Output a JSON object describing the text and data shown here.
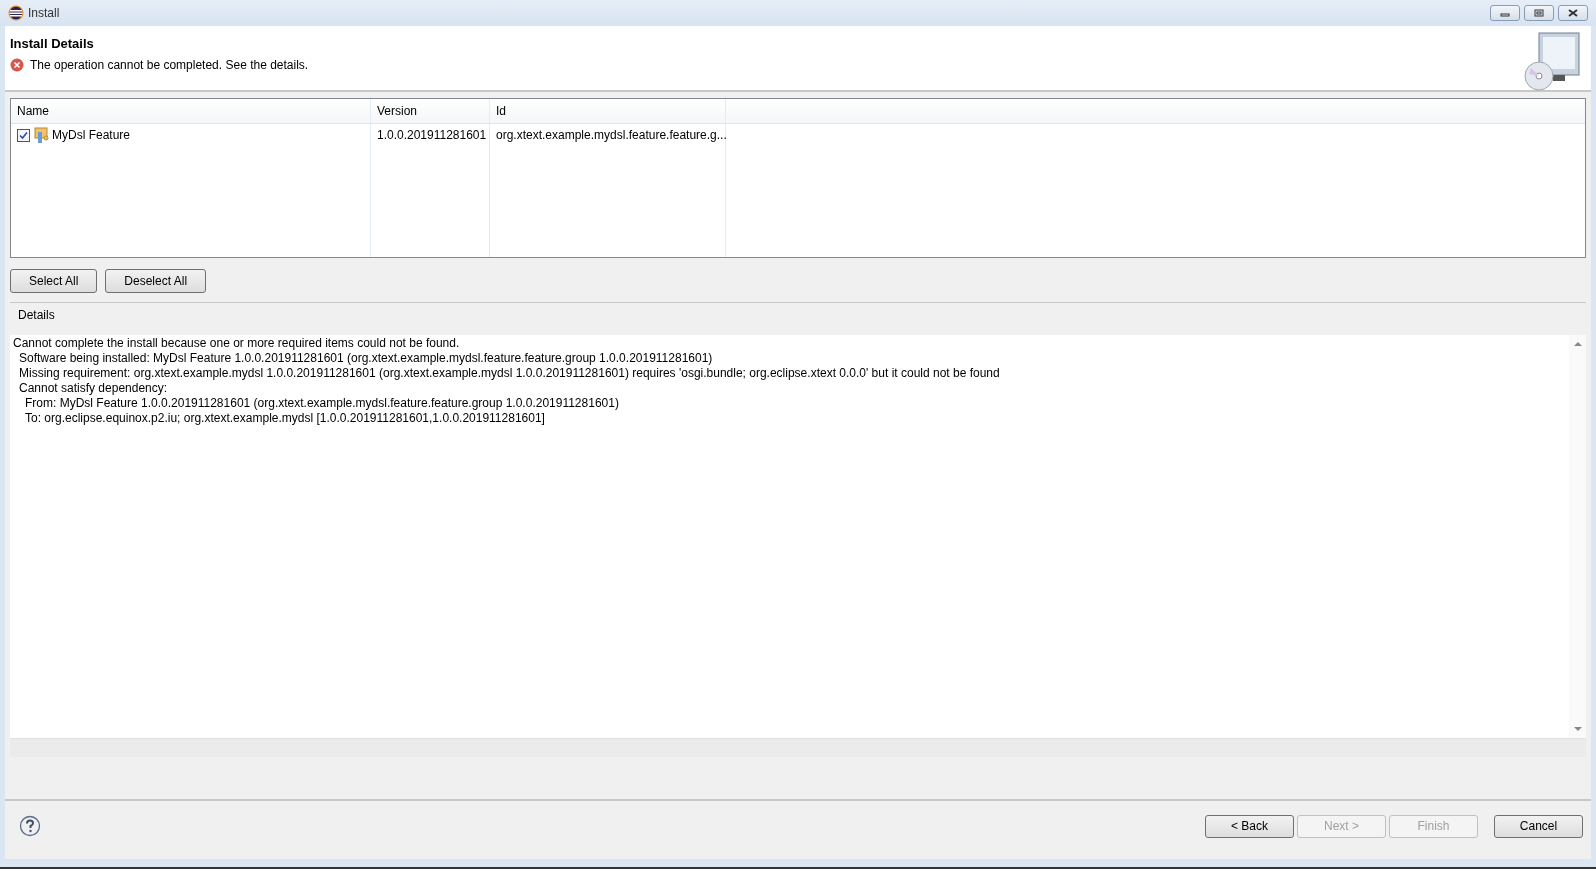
{
  "window": {
    "title": "Install"
  },
  "header": {
    "title": "Install Details",
    "message": "The operation cannot be completed.  See the details."
  },
  "table": {
    "columns": [
      "Name",
      "Version",
      "Id"
    ],
    "rows": [
      {
        "name": "MyDsl Feature",
        "version": "1.0.0.201911281601",
        "id": "org.xtext.example.mydsl.feature.feature.g...",
        "checked": true
      }
    ]
  },
  "selection_buttons": [
    "Select All",
    "Deselect All"
  ],
  "details": {
    "label": "Details",
    "lines": [
      {
        "text": "Cannot complete the install because one or more required items could not be found.",
        "children": [
          {
            "text": "Software being installed: MyDsl Feature 1.0.0.201911281601 (org.xtext.example.mydsl.feature.feature.group 1.0.0.201911281601)"
          },
          {
            "text": "Missing requirement: org.xtext.example.mydsl 1.0.0.201911281601 (org.xtext.example.mydsl 1.0.0.201911281601) requires 'osgi.bundle; org.eclipse.xtext 0.0.0' but it could not be found"
          },
          {
            "text": "Cannot satisfy dependency:",
            "children": [
              {
                "text": "From: MyDsl Feature 1.0.0.201911281601 (org.xtext.example.mydsl.feature.feature.group 1.0.0.201911281601)"
              },
              {
                "text": "To: org.eclipse.equinox.p2.iu; org.xtext.example.mydsl [1.0.0.201911281601,1.0.0.201911281601]"
              }
            ]
          }
        ]
      }
    ]
  },
  "footer_buttons": [
    {
      "label": "< Back",
      "disabled": false
    },
    {
      "label": "Next >",
      "disabled": true
    },
    {
      "label": "Finish",
      "disabled": true
    },
    {
      "label": "Cancel",
      "disabled": false
    }
  ]
}
